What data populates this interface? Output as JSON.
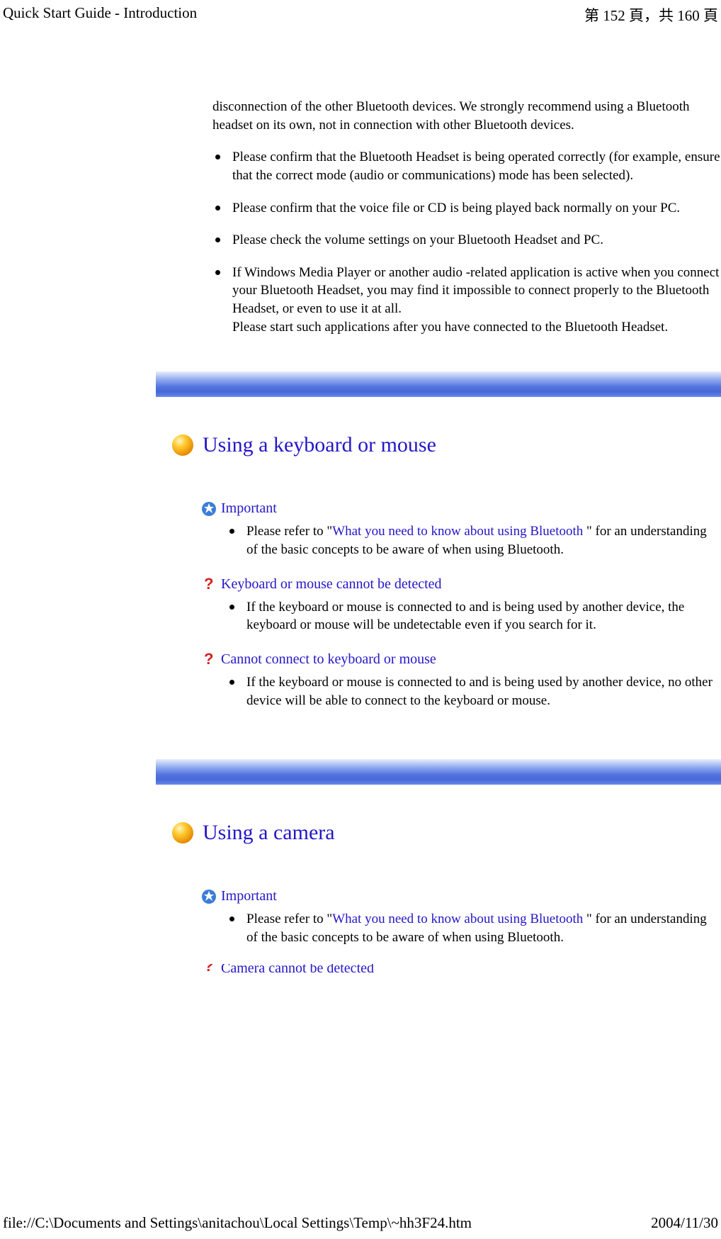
{
  "header": {
    "title": "Quick Start Guide - Introduction",
    "page_label_pre": "第 ",
    "page_current": "152",
    "page_label_mid": " 頁，共 ",
    "page_total": "160",
    "page_label_post": " 頁"
  },
  "intro": "disconnection of the other Bluetooth devices. We strongly recommend using a Bluetooth headset on its own, not in connection with other Bluetooth devices.",
  "bullets": [
    "Please confirm that the Bluetooth Headset is being operated correctly (for example, ensure that the correct mode (audio or communications) mode has been selected).",
    "Please confirm that the voice file or CD is being played back normally on your PC.",
    "Please check the volume settings on your Bluetooth Headset and PC.",
    "If Windows Media Player or another audio -related application is active when you connect your Bluetooth Headset, you may find it impossible to connect properly to the Bluetooth Headset, or even to use it at all.\nPlease start such applications after you have connected to the Bluetooth Headset."
  ],
  "section_keyboard": {
    "title": "Using a keyboard or mouse",
    "important_label": "Important",
    "important_text_pre": "Please refer to \"",
    "important_link": "What you need to know about using Bluetooth",
    "important_text_post": " \" for an understanding of the basic concepts to be aware of when using Bluetooth.",
    "q1_title": "Keyboard or mouse cannot be detected",
    "q1_text": "If the keyboard or mouse is connected to and is being used by another device, the keyboard or mouse will be undetectable even if you search for it.",
    "q2_title": "Cannot connect to keyboard or mouse",
    "q2_text": "If the keyboard or mouse is connected to and is being used by another device, no other device will be able to connect to the keyboard or mouse."
  },
  "section_camera": {
    "title": "Using a camera",
    "important_label": "Important",
    "important_text_pre": "Please refer to \"",
    "important_link": "What you need to know about using Bluetooth",
    "important_text_post": " \" for an understanding of the basic concepts to be aware of when using Bluetooth.",
    "q_truncated": "Camera cannot be detected"
  },
  "footer": {
    "path": "file://C:\\Documents and Settings\\anitachou\\Local Settings\\Temp\\~hh3F24.htm",
    "date": "2004/11/30"
  }
}
